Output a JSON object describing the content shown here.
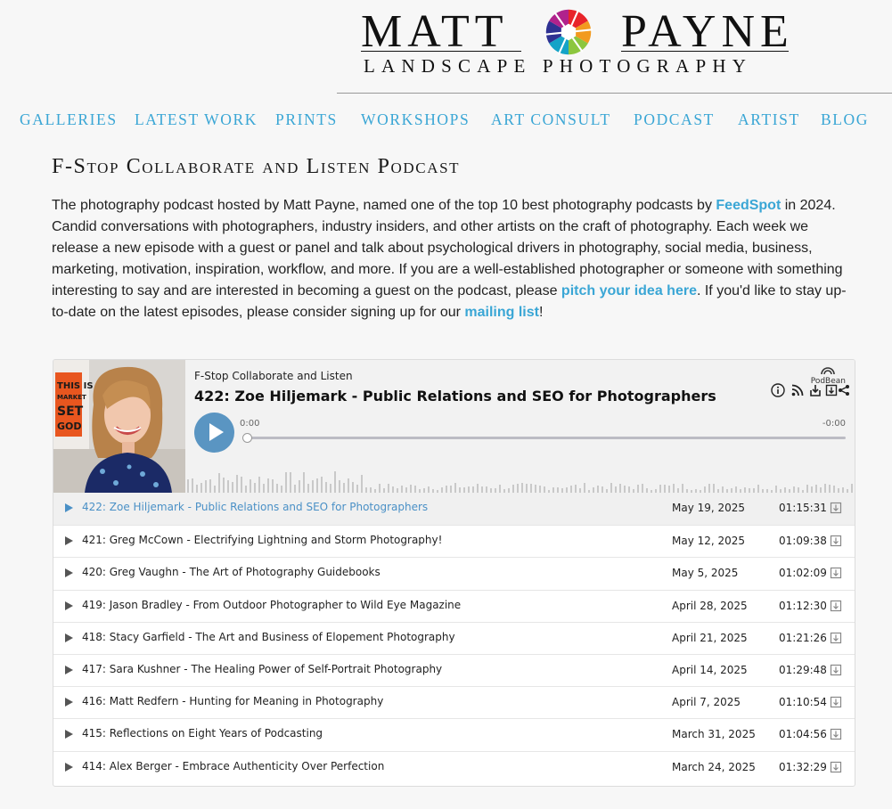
{
  "brand": {
    "name_left": "MATT",
    "name_right": "PAYNE",
    "tagline": "LANDSCAPE PHOTOGRAPHY"
  },
  "nav": {
    "items": [
      "GALLERIES",
      "LATEST WORK",
      "PRINTS",
      "WORKSHOPS",
      "ART CONSULT",
      "PODCAST",
      "ARTIST",
      "BLOG"
    ]
  },
  "page": {
    "title": "F-Stop Collaborate and Listen Podcast",
    "intro": {
      "p1": "The photography podcast hosted by Matt Payne, named one of the top 10 best photography podcasts by ",
      "link_feedspot": "FeedSpot",
      "p2": " in 2024. Candid conversations with photographers, industry insiders, and other artists on the craft of photography. Each week we release a new episode with a guest or panel and talk about psychological drivers in photography, social media, business, marketing, motivation, inspiration, workflow, and more. If you are a well-established photographer or someone with something interesting to say and are interested in becoming a guest on the podcast, please ",
      "link_pitch": "pitch your idea here",
      "p3": ". If you'd like to stay up-to-date on the latest episodes, please consider signing up for our ",
      "link_mailing": "mailing list",
      "p4": "!"
    }
  },
  "player": {
    "show_name": "F-Stop Collaborate and Listen",
    "episode_title": "422: Zoe Hiljemark - Public Relations and SEO for Photographers",
    "brand": "PodBean",
    "time_current": "0:00",
    "time_remaining": "-0:00",
    "progress": 0,
    "cover_text": [
      "THIS IS",
      "MARKET",
      "SET",
      "GOD"
    ],
    "icons": [
      "info-icon",
      "rss-icon",
      "subscribe-icon",
      "download-icon",
      "share-icon"
    ],
    "episodes": [
      {
        "title": "422: Zoe Hiljemark - Public Relations and SEO for Photographers",
        "date": "May 19, 2025",
        "duration": "01:15:31",
        "active": true
      },
      {
        "title": "421: Greg McCown - Electrifying Lightning and Storm Photography!",
        "date": "May 12, 2025",
        "duration": "01:09:38"
      },
      {
        "title": "420: Greg Vaughn - The Art of Photography Guidebooks",
        "date": "May 5, 2025",
        "duration": "01:02:09"
      },
      {
        "title": "419: Jason Bradley - From Outdoor Photographer to Wild Eye Magazine",
        "date": "April 28, 2025",
        "duration": "01:12:30"
      },
      {
        "title": "418: Stacy Garfield - The Art and Business of Elopement Photography",
        "date": "April 21, 2025",
        "duration": "01:21:26"
      },
      {
        "title": "417: Sara Kushner - The Healing Power of Self-Portrait Photography",
        "date": "April 14, 2025",
        "duration": "01:29:48"
      },
      {
        "title": "416: Matt Redfern - Hunting for Meaning in Photography",
        "date": "April 7, 2025",
        "duration": "01:10:54"
      },
      {
        "title": "415: Reflections on Eight Years of Podcasting",
        "date": "March 31, 2025",
        "duration": "01:04:56"
      },
      {
        "title": "414: Alex Berger - Embrace Authenticity Over Perfection",
        "date": "March 24, 2025",
        "duration": "01:32:29"
      }
    ]
  },
  "colors": {
    "link": "#3aa6d5",
    "play_button": "#5a95c2",
    "active_episode": "#4a90c6",
    "background": "#f7f7f7"
  }
}
